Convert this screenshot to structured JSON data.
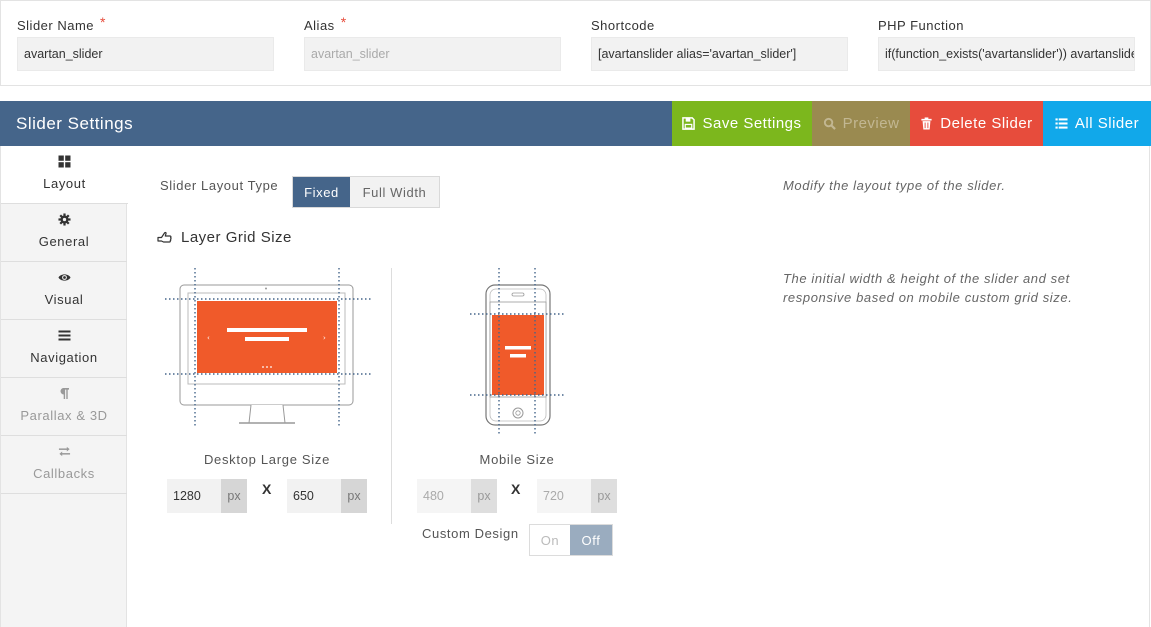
{
  "fields": {
    "slider_name": {
      "label": "Slider Name",
      "required_mark": "*",
      "value": "avartan_slider"
    },
    "alias": {
      "label": "Alias",
      "required_mark": "*",
      "value": "avartan_slider"
    },
    "shortcode": {
      "label": "Shortcode",
      "value": "[avartanslider alias='avartan_slider']"
    },
    "php_function": {
      "label": "PHP Function",
      "value": "if(function_exists('avartanslider')) avartanslider('avartan_slider');"
    }
  },
  "settings_bar": {
    "title": "Slider Settings",
    "buttons": {
      "save": {
        "label": "Save Settings",
        "icon": "floppy-icon"
      },
      "preview": {
        "label": "Preview",
        "icon": "search-icon"
      },
      "delete": {
        "label": "Delete Slider",
        "icon": "trash-icon"
      },
      "all": {
        "label": "All Slider",
        "icon": "list-icon"
      }
    },
    "colors": {
      "bar": "#45658a",
      "save": "#7cb71d",
      "preview": "#9a8a50",
      "delete": "#e74c3c",
      "all": "#11a8ea"
    }
  },
  "tabs": [
    {
      "label": "Layout",
      "icon": "grid-icon",
      "active": true
    },
    {
      "label": "General",
      "icon": "gear-icon"
    },
    {
      "label": "Visual",
      "icon": "eye-icon"
    },
    {
      "label": "Navigation",
      "icon": "bars-icon"
    },
    {
      "label": "Parallax & 3D",
      "icon": "pilcrow-icon",
      "disabled": true
    },
    {
      "label": "Callbacks",
      "icon": "exchange-icon",
      "disabled": true
    }
  ],
  "layout": {
    "layout_type_label": "Slider Layout Type",
    "layout_type_options": [
      "Fixed",
      "Full Width"
    ],
    "layout_type_selected": "Fixed",
    "layout_type_hint": "Modify the layout type of the slider.",
    "grid_title": "Layer Grid Size",
    "grid_hint_line1": "The initial width & height of the slider and set",
    "grid_hint_line2": "responsive based on mobile custom grid size.",
    "desktop": {
      "label": "Desktop Large Size",
      "width": "1280",
      "height": "650",
      "unit": "px"
    },
    "mobile": {
      "label": "Mobile Size",
      "width": "480",
      "height": "720",
      "unit": "px"
    },
    "times_sign": "X",
    "custom_design": {
      "label": "Custom Design",
      "on_label": "On",
      "off_label": "Off",
      "value": "Off"
    },
    "accent_color": "#f05a2a"
  }
}
